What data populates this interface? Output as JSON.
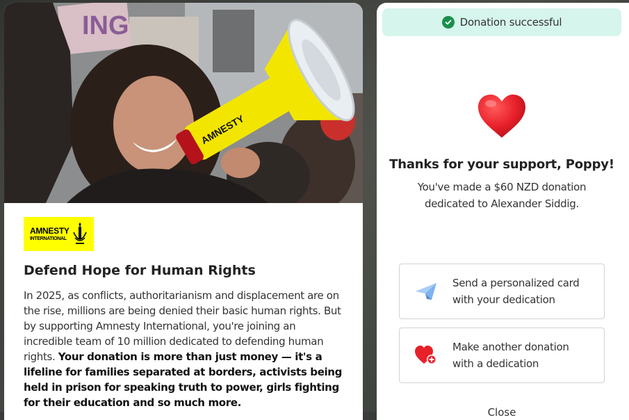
{
  "campaign": {
    "logo": {
      "line1": "AMNESTY",
      "line2": "INTERNATIONAL"
    },
    "title": "Defend Hope for Human Rights",
    "body_regular": "In 2025, as conflicts, authoritarianism and displacement are on the rise, millions are being denied their basic human rights. But by supporting Amnesty International, you're joining an incredible team of 10 million dedicated to defending human rights. ",
    "body_bold": "Your donation is more than just money — it's a lifeline for families separated at borders, activists being held in prison for speaking truth to power, girls fighting for their education and so much more.",
    "hero_sign_text": "ING",
    "megaphone_text": "AMNESTY"
  },
  "confirmation": {
    "toast": "Donation successful",
    "title": "Thanks for your support, Poppy!",
    "subtitle": "You've made a $60 NZD donation dedicated to Alexander Siddig.",
    "actions": [
      {
        "label": "Send a personalized card with your dedication",
        "icon": "paper-plane-icon"
      },
      {
        "label": "Make another donation with a dedication",
        "icon": "heart-plus-icon"
      }
    ],
    "close_label": "Close"
  },
  "colors": {
    "toast_bg": "#d6f5ec",
    "success_green": "#1a8f4c",
    "heart_red": "#e8202a",
    "logo_yellow": "#ffff00",
    "plane_blue": "#5b9be0"
  }
}
